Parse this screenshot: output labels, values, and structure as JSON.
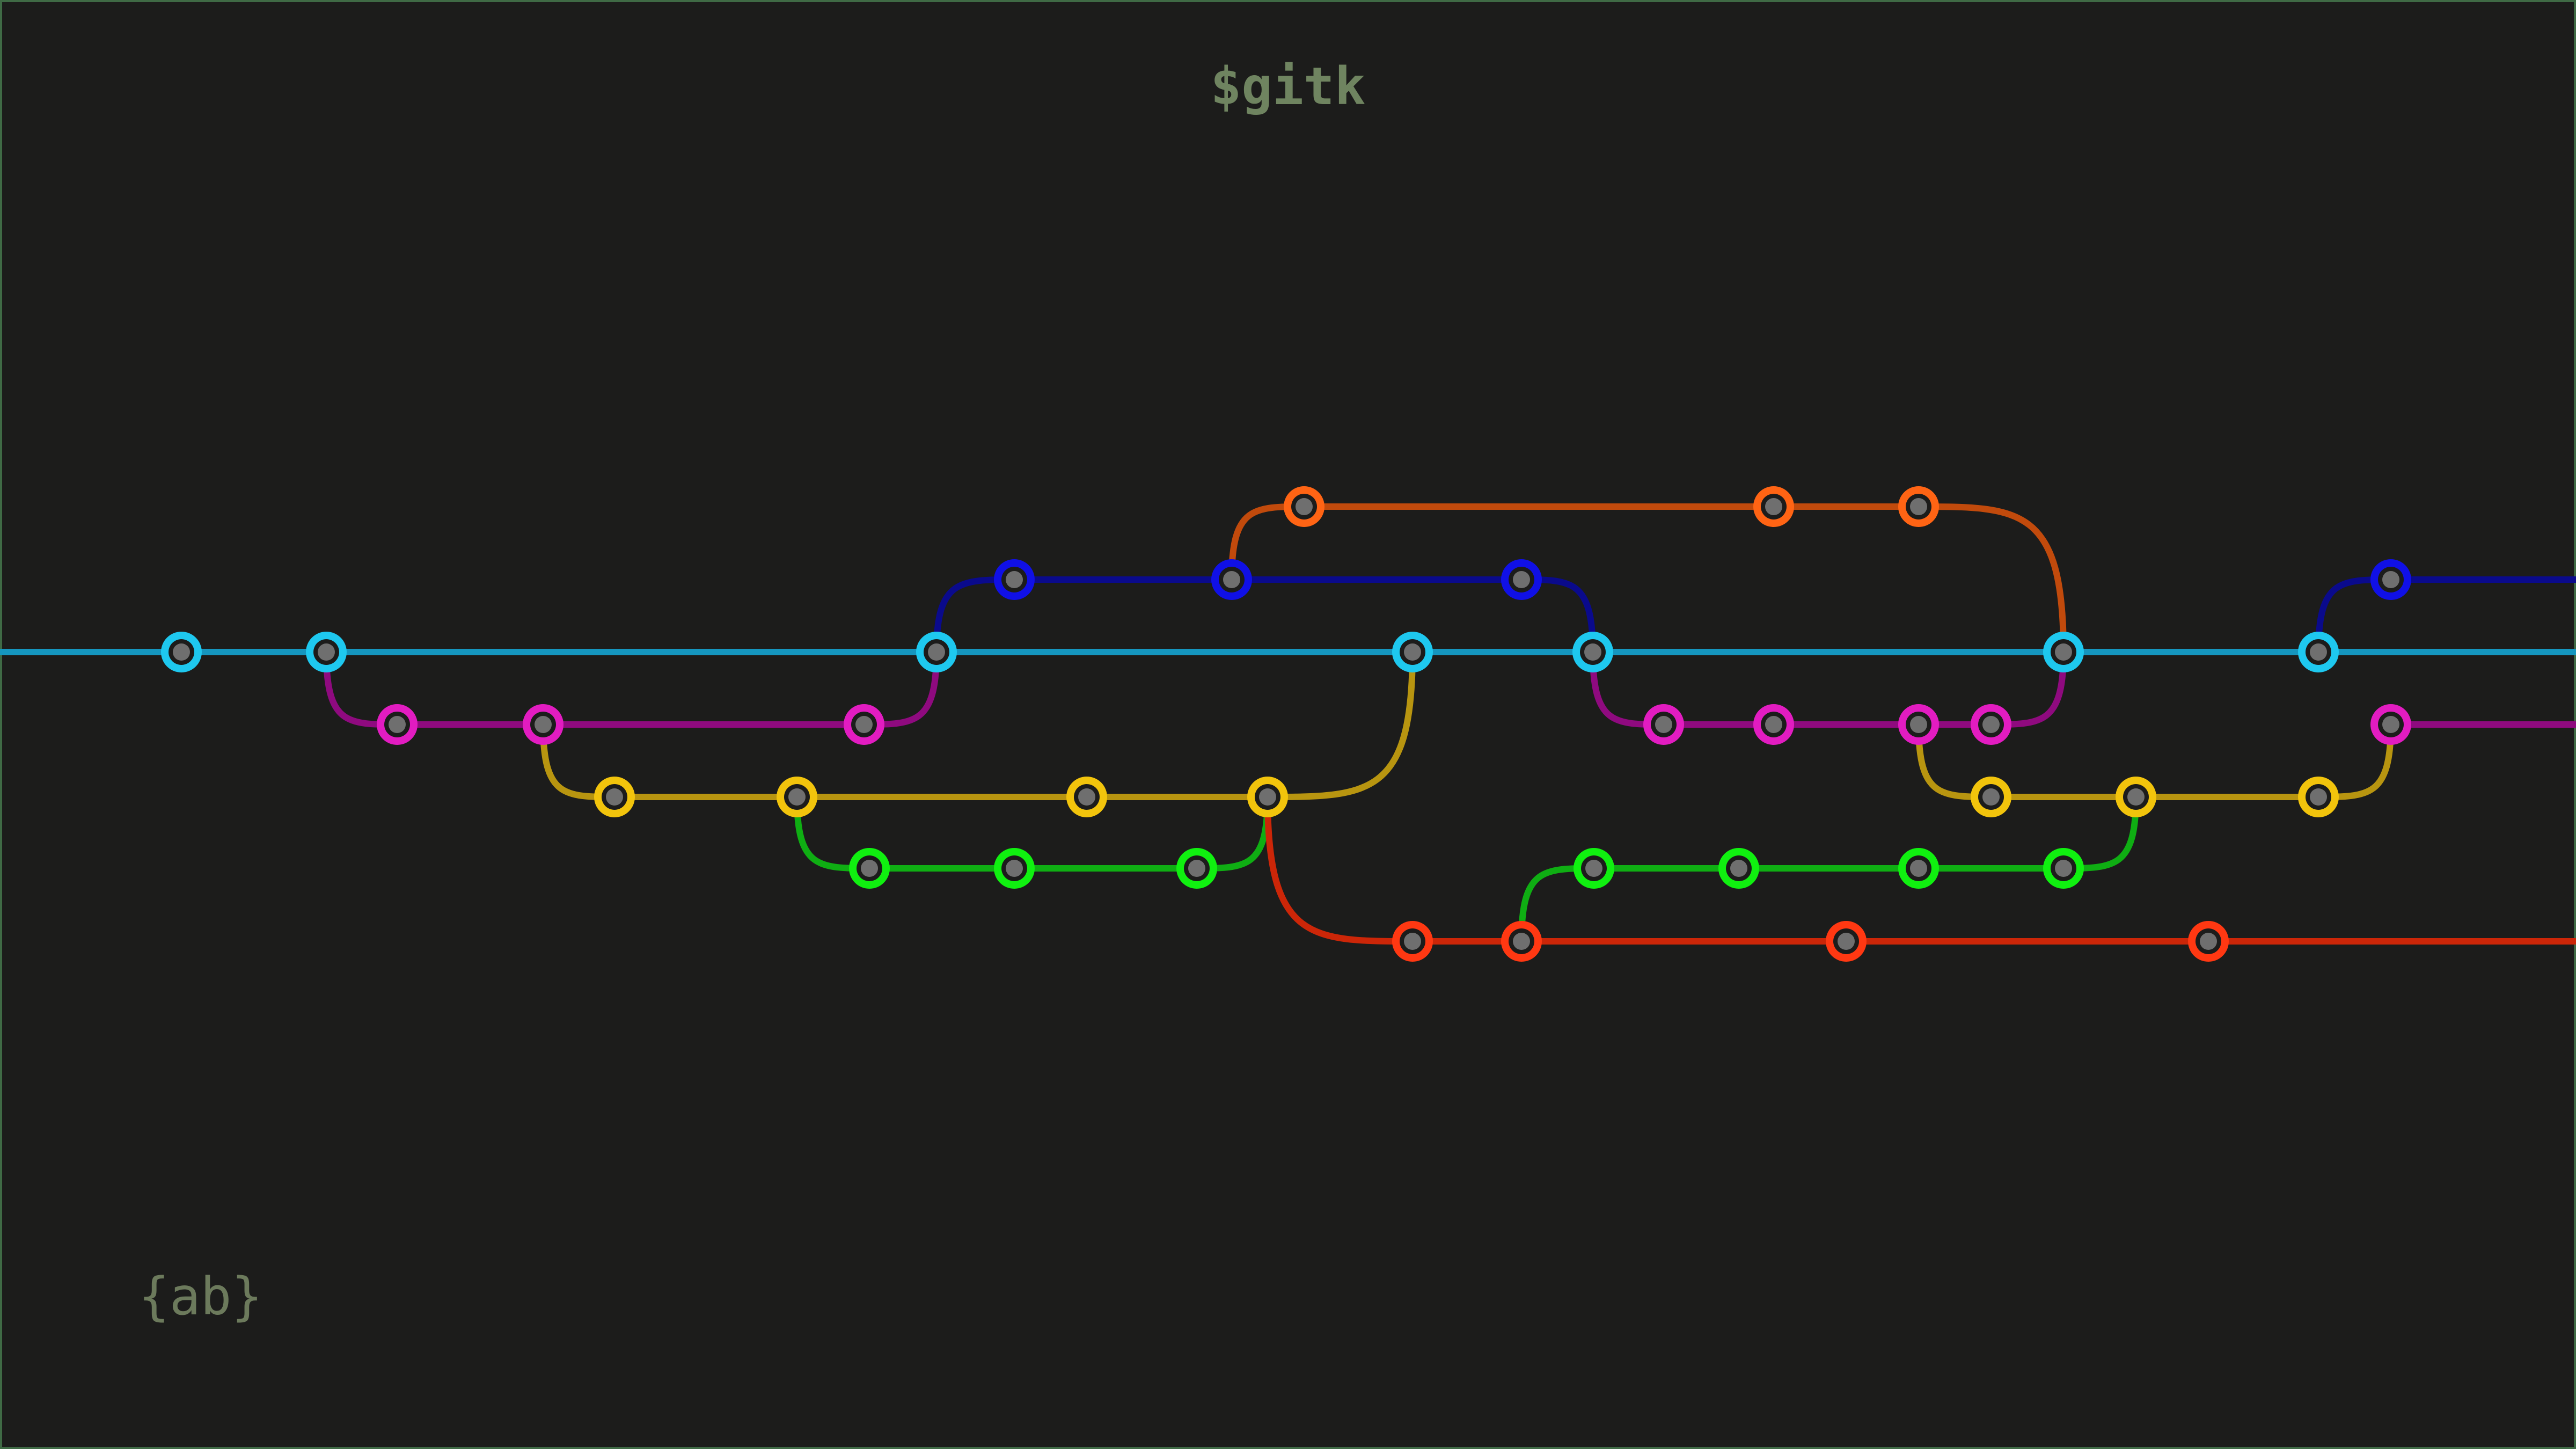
{
  "title": "$gitk",
  "logo": "{ab}",
  "colors": {
    "background": "#1c1c1b",
    "commit_center": "#6f6f6f",
    "cyan": "#1ec8ef",
    "magenta": "#e21cc1",
    "yellow": "#f2c40c",
    "green": "#10f010",
    "blue": "#1010e6",
    "orange": "#ff6414",
    "red": "#ff3812"
  },
  "branches": [
    {
      "id": "cyan",
      "color": "#1ec8ef",
      "line": "#1596bf"
    },
    {
      "id": "magenta",
      "color": "#e21cc1",
      "line": "#8f0a7f"
    },
    {
      "id": "yellow",
      "color": "#f2c40c",
      "line": "#b89510"
    },
    {
      "id": "green",
      "color": "#10f010",
      "line": "#0fae13"
    },
    {
      "id": "blue",
      "color": "#1010e6",
      "line": "#0a0a8c"
    },
    {
      "id": "orange",
      "color": "#ff6414",
      "line": "#c14a0c"
    },
    {
      "id": "red",
      "color": "#ff3812",
      "line": "#cc2608"
    }
  ]
}
